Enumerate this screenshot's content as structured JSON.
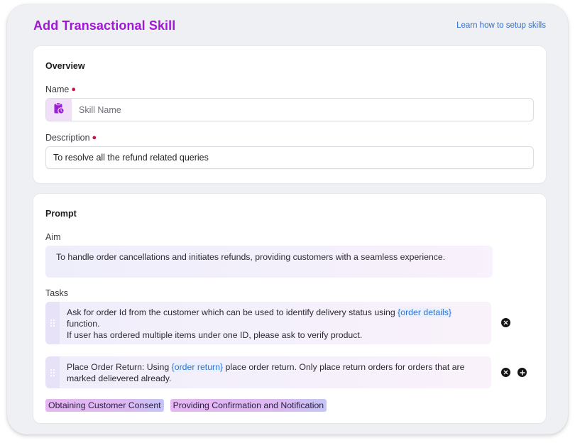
{
  "header": {
    "title": "Add Transactional Skill",
    "help_link": "Learn how to setup skills"
  },
  "overview": {
    "section_title": "Overview",
    "name_field": {
      "label": "Name",
      "required": true,
      "value": "",
      "placeholder": "Skill Name",
      "icon": "clipboard-clock-icon"
    },
    "description_field": {
      "label": "Description",
      "required": true,
      "value": "To resolve all the refund related queries",
      "placeholder": ""
    }
  },
  "prompt": {
    "section_title": "Prompt",
    "aim": {
      "label": "Aim",
      "text": "To handle order cancellations and initiates refunds, providing customers with a seamless experience."
    },
    "tasks_label": "Tasks",
    "tasks": [
      {
        "pre": "Ask for order Id from the customer which can be used to identify delivery status using ",
        "variable": "{order details}",
        "post": " function.",
        "line2": "If user has ordered multiple items under one ID, please ask to verify product.",
        "actions": [
          "remove"
        ]
      },
      {
        "pre": "Place Order Return: Using ",
        "variable": "{order return}",
        "post": " place order return. Only place return orders for orders that are marked delievered already.",
        "line2": "",
        "actions": [
          "remove",
          "add"
        ]
      }
    ],
    "suggestions": [
      "Obtaining Customer Consent",
      "Providing Confirmation and Notification"
    ]
  },
  "colors": {
    "title_accent": "#a018d6",
    "link": "#2a6fd6",
    "required_marker": "#c8104e",
    "variable": "#2a73d8"
  }
}
